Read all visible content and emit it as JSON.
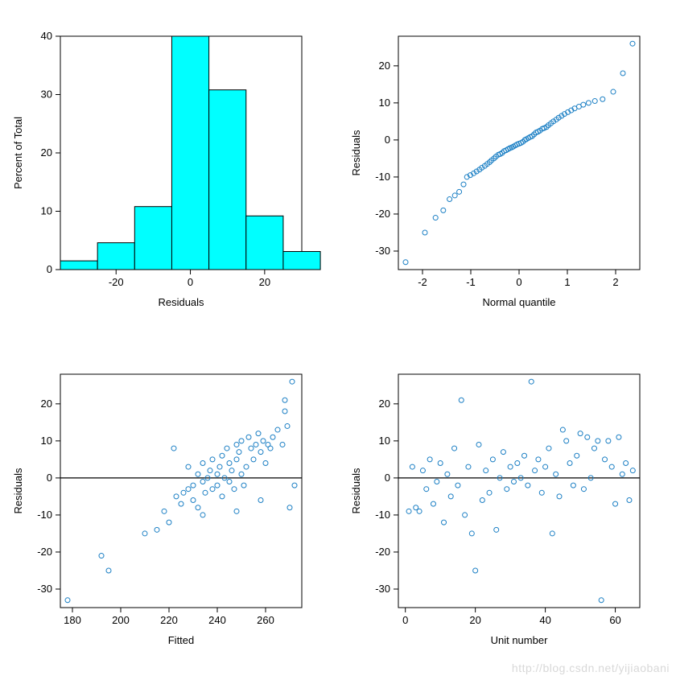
{
  "watermark": "http://blog.csdn.net/yijiaobani",
  "chart_data": [
    {
      "type": "bar",
      "title": "",
      "xlabel": "Residuals",
      "ylabel": "Percent of Total",
      "xlim": [
        -35,
        30
      ],
      "ylim": [
        0,
        40
      ],
      "xticks": [
        -20,
        0,
        20
      ],
      "yticks": [
        0,
        10,
        20,
        30,
        40
      ],
      "bin_width": 10,
      "categories": [
        -35,
        -25,
        -15,
        -5,
        5,
        15,
        25
      ],
      "values": [
        1.5,
        4.6,
        10.8,
        40.0,
        30.8,
        9.2,
        3.1
      ]
    },
    {
      "type": "scatter",
      "title": "",
      "xlabel": "Normal quantile",
      "ylabel": "Residuals",
      "xlim": [
        -2.5,
        2.5
      ],
      "ylim": [
        -35,
        28
      ],
      "xticks": [
        -2,
        -1,
        0,
        1,
        2
      ],
      "yticks": [
        -30,
        -20,
        -10,
        0,
        10,
        20
      ],
      "series": [
        {
          "name": "qq",
          "points": [
            [
              -2.35,
              -33
            ],
            [
              -1.95,
              -25
            ],
            [
              -1.73,
              -21
            ],
            [
              -1.57,
              -19
            ],
            [
              -1.44,
              -16
            ],
            [
              -1.33,
              -15
            ],
            [
              -1.24,
              -14
            ],
            [
              -1.15,
              -12
            ],
            [
              -1.08,
              -10
            ],
            [
              -1.01,
              -9.5
            ],
            [
              -0.94,
              -9
            ],
            [
              -0.88,
              -8.5
            ],
            [
              -0.82,
              -8
            ],
            [
              -0.77,
              -7.5
            ],
            [
              -0.71,
              -7
            ],
            [
              -0.66,
              -6.5
            ],
            [
              -0.61,
              -6
            ],
            [
              -0.57,
              -5.5
            ],
            [
              -0.52,
              -5
            ],
            [
              -0.48,
              -4.5
            ],
            [
              -0.43,
              -4
            ],
            [
              -0.39,
              -3.8
            ],
            [
              -0.35,
              -3.5
            ],
            [
              -0.31,
              -3
            ],
            [
              -0.27,
              -2.8
            ],
            [
              -0.23,
              -2.5
            ],
            [
              -0.19,
              -2.2
            ],
            [
              -0.15,
              -2
            ],
            [
              -0.12,
              -1.8
            ],
            [
              -0.08,
              -1.5
            ],
            [
              -0.04,
              -1.2
            ],
            [
              0,
              -1
            ],
            [
              0.04,
              -0.8
            ],
            [
              0.08,
              -0.5
            ],
            [
              0.12,
              0
            ],
            [
              0.15,
              0.2
            ],
            [
              0.19,
              0.5
            ],
            [
              0.23,
              0.8
            ],
            [
              0.27,
              1
            ],
            [
              0.31,
              1.5
            ],
            [
              0.35,
              2
            ],
            [
              0.39,
              2.2
            ],
            [
              0.43,
              2.5
            ],
            [
              0.48,
              3
            ],
            [
              0.52,
              3.2
            ],
            [
              0.57,
              3.5
            ],
            [
              0.61,
              4
            ],
            [
              0.66,
              4.5
            ],
            [
              0.71,
              5
            ],
            [
              0.77,
              5.5
            ],
            [
              0.82,
              6
            ],
            [
              0.88,
              6.5
            ],
            [
              0.94,
              7
            ],
            [
              1.01,
              7.5
            ],
            [
              1.08,
              8
            ],
            [
              1.15,
              8.5
            ],
            [
              1.24,
              9
            ],
            [
              1.33,
              9.5
            ],
            [
              1.44,
              10
            ],
            [
              1.57,
              10.5
            ],
            [
              1.73,
              11
            ],
            [
              1.95,
              13
            ],
            [
              2.15,
              18
            ],
            [
              2.35,
              26
            ]
          ]
        }
      ]
    },
    {
      "type": "scatter",
      "title": "",
      "xlabel": "Fitted",
      "ylabel": "Residuals",
      "xlim": [
        175,
        275
      ],
      "ylim": [
        -35,
        28
      ],
      "xticks": [
        180,
        200,
        220,
        240,
        260
      ],
      "yticks": [
        -30,
        -20,
        -10,
        0,
        10,
        20
      ],
      "hline": 0,
      "series": [
        {
          "name": "resid-fitted",
          "points": [
            [
              178,
              -33
            ],
            [
              192,
              -21
            ],
            [
              195,
              -25
            ],
            [
              210,
              -15
            ],
            [
              215,
              -14
            ],
            [
              218,
              -9
            ],
            [
              220,
              -12
            ],
            [
              222,
              8
            ],
            [
              223,
              -5
            ],
            [
              225,
              -7
            ],
            [
              226,
              -4
            ],
            [
              228,
              -3
            ],
            [
              228,
              3
            ],
            [
              230,
              -6
            ],
            [
              230,
              -2
            ],
            [
              232,
              -8
            ],
            [
              232,
              1
            ],
            [
              234,
              -1
            ],
            [
              234,
              4
            ],
            [
              235,
              -4
            ],
            [
              236,
              0
            ],
            [
              237,
              2
            ],
            [
              238,
              5
            ],
            [
              238,
              -3
            ],
            [
              240,
              1
            ],
            [
              240,
              -2
            ],
            [
              241,
              3
            ],
            [
              242,
              -5
            ],
            [
              242,
              6
            ],
            [
              243,
              0
            ],
            [
              244,
              8
            ],
            [
              245,
              -1
            ],
            [
              245,
              4
            ],
            [
              246,
              2
            ],
            [
              247,
              -3
            ],
            [
              248,
              9
            ],
            [
              248,
              5
            ],
            [
              249,
              7
            ],
            [
              250,
              1
            ],
            [
              250,
              10
            ],
            [
              251,
              -2
            ],
            [
              252,
              3
            ],
            [
              253,
              11
            ],
            [
              254,
              8
            ],
            [
              255,
              5
            ],
            [
              256,
              9
            ],
            [
              257,
              12
            ],
            [
              258,
              7
            ],
            [
              259,
              10
            ],
            [
              260,
              4
            ],
            [
              261,
              9
            ],
            [
              262,
              8
            ],
            [
              263,
              11
            ],
            [
              265,
              13
            ],
            [
              267,
              9
            ],
            [
              268,
              18
            ],
            [
              269,
              14
            ],
            [
              270,
              -8
            ],
            [
              271,
              26
            ],
            [
              272,
              -2
            ],
            [
              268,
              21
            ],
            [
              258,
              -6
            ],
            [
              248,
              -9
            ],
            [
              234,
              -10
            ]
          ]
        }
      ]
    },
    {
      "type": "scatter",
      "title": "",
      "xlabel": "Unit number",
      "ylabel": "Residuals",
      "xlim": [
        -2,
        67
      ],
      "ylim": [
        -35,
        28
      ],
      "xticks": [
        0,
        20,
        40,
        60
      ],
      "yticks": [
        -30,
        -20,
        -10,
        0,
        10,
        20
      ],
      "hline": 0,
      "series": [
        {
          "name": "resid-unit",
          "points": [
            [
              1,
              -9
            ],
            [
              2,
              3
            ],
            [
              3,
              -8
            ],
            [
              4,
              -9
            ],
            [
              5,
              2
            ],
            [
              6,
              -3
            ],
            [
              7,
              5
            ],
            [
              8,
              -7
            ],
            [
              9,
              -1
            ],
            [
              10,
              4
            ],
            [
              11,
              -12
            ],
            [
              12,
              1
            ],
            [
              13,
              -5
            ],
            [
              14,
              8
            ],
            [
              15,
              -2
            ],
            [
              16,
              21
            ],
            [
              17,
              -10
            ],
            [
              18,
              3
            ],
            [
              19,
              -15
            ],
            [
              20,
              -25
            ],
            [
              21,
              9
            ],
            [
              22,
              -6
            ],
            [
              23,
              2
            ],
            [
              24,
              -4
            ],
            [
              25,
              5
            ],
            [
              26,
              -14
            ],
            [
              27,
              0
            ],
            [
              28,
              7
            ],
            [
              29,
              -3
            ],
            [
              30,
              3
            ],
            [
              31,
              -1
            ],
            [
              32,
              4
            ],
            [
              33,
              0
            ],
            [
              34,
              6
            ],
            [
              35,
              -2
            ],
            [
              36,
              26
            ],
            [
              37,
              2
            ],
            [
              38,
              5
            ],
            [
              39,
              -4
            ],
            [
              40,
              3
            ],
            [
              41,
              8
            ],
            [
              42,
              -15
            ],
            [
              43,
              1
            ],
            [
              44,
              -5
            ],
            [
              45,
              13
            ],
            [
              46,
              10
            ],
            [
              47,
              4
            ],
            [
              48,
              -2
            ],
            [
              49,
              6
            ],
            [
              50,
              12
            ],
            [
              51,
              -3
            ],
            [
              52,
              11
            ],
            [
              53,
              0
            ],
            [
              54,
              8
            ],
            [
              55,
              10
            ],
            [
              56,
              -33
            ],
            [
              57,
              5
            ],
            [
              58,
              10
            ],
            [
              59,
              3
            ],
            [
              60,
              -7
            ],
            [
              61,
              11
            ],
            [
              62,
              1
            ],
            [
              63,
              4
            ],
            [
              64,
              -6
            ],
            [
              65,
              2
            ]
          ]
        }
      ]
    }
  ]
}
